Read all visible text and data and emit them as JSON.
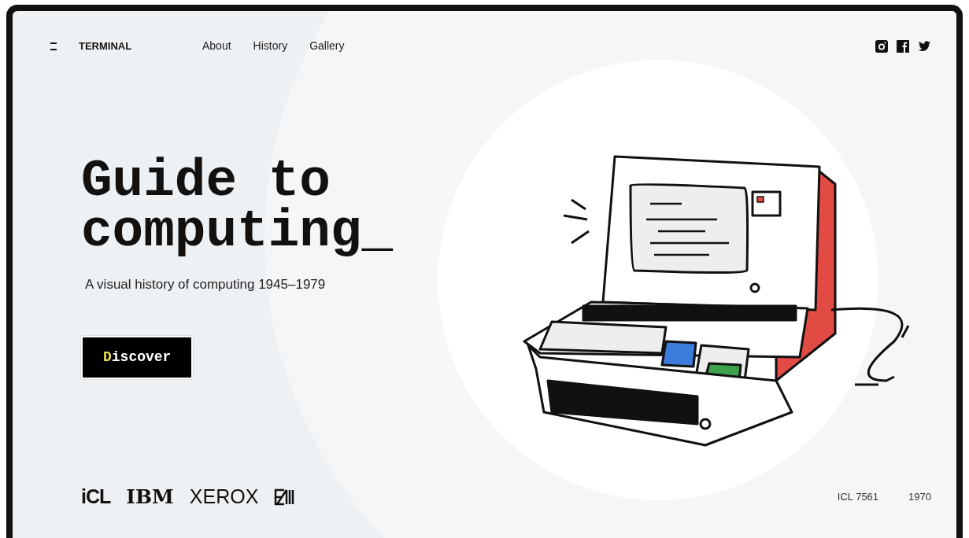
{
  "brand": "TERMINAL",
  "nav": [
    {
      "label": "About"
    },
    {
      "label": "History"
    },
    {
      "label": "Gallery"
    }
  ],
  "social": [
    {
      "kind": "instagram"
    },
    {
      "kind": "facebook"
    },
    {
      "kind": "twitter"
    }
  ],
  "hero": {
    "title": "Guide to computing_",
    "subtitle": "A visual history of computing 1945–1979",
    "button": "Discover"
  },
  "logos": [
    {
      "kind": "text",
      "text": "iCL"
    },
    {
      "kind": "text",
      "text": "IBM"
    },
    {
      "kind": "text",
      "text": "XEROX"
    },
    {
      "kind": "mark"
    }
  ],
  "caption": {
    "model": "ICL 7561",
    "year": "1970"
  }
}
